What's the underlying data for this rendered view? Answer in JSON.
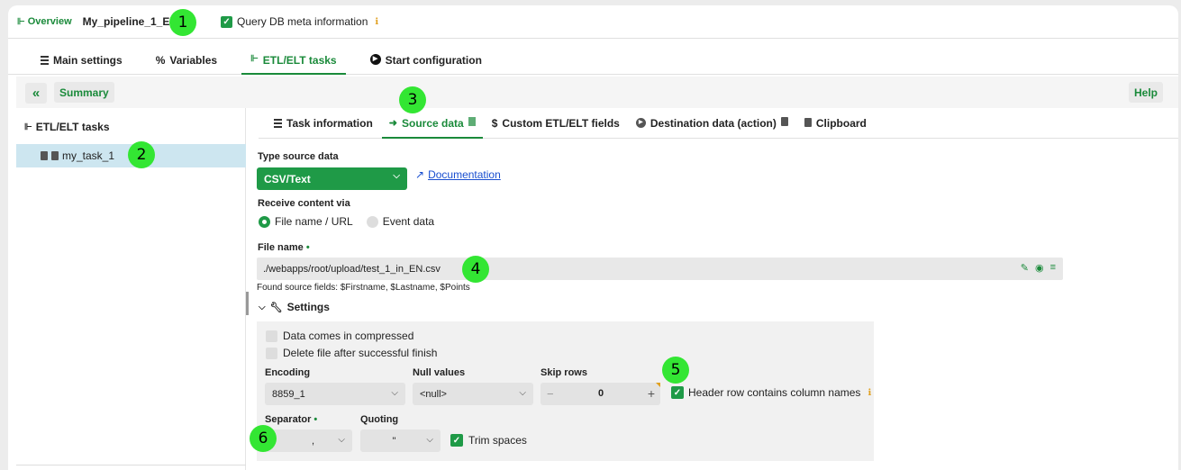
{
  "topbar": {
    "overview_label": "Overview",
    "pipeline_name": "My_pipeline_1_EN",
    "query_db_label": "Query DB meta information",
    "query_db_checked": true
  },
  "main_tabs": [
    {
      "label": "Main settings",
      "icon": "list-icon",
      "active": false
    },
    {
      "label": "Variables",
      "icon": "percent-icon",
      "active": false
    },
    {
      "label": "ETL/ELT tasks",
      "icon": "tree-icon",
      "active": true
    },
    {
      "label": "Start configuration",
      "icon": "play-icon",
      "active": false
    }
  ],
  "toolbar": {
    "collapse_label": "«",
    "summary_label": "Summary",
    "help_label": "Help"
  },
  "left_panel": {
    "title": "ETL/ELT tasks",
    "tasks": [
      {
        "label": "my_task_1",
        "selected": true
      }
    ]
  },
  "task_tabs": [
    {
      "label": "Task information",
      "icon": "list-icon",
      "active": false
    },
    {
      "label": "Source data",
      "icon": "arrow-right-icon",
      "active": true
    },
    {
      "label": "Custom ETL/ELT fields",
      "icon": "dollar-icon",
      "active": false
    },
    {
      "label": "Destination data (action)",
      "icon": "play-icon",
      "active": false
    },
    {
      "label": "Clipboard",
      "icon": "clipboard-icon",
      "active": false
    }
  ],
  "source": {
    "type_label": "Type source data",
    "type_value": "CSV/Text",
    "documentation_label": "Documentation",
    "receive_label": "Receive content via",
    "receive_options": [
      {
        "label": "File name / URL",
        "selected": true
      },
      {
        "label": "Event data",
        "selected": false
      }
    ],
    "file_name_label": "File name",
    "required_mark": "•",
    "file_name_value": "./webapps/root/upload/test_1_in_EN.csv",
    "found_fields": "Found source fields: $Firstname, $Lastname, $Points"
  },
  "settings": {
    "title": "Settings",
    "compressed_label": "Data comes in compressed",
    "delete_label": "Delete file after successful finish",
    "encoding_label": "Encoding",
    "encoding_value": "8859_1",
    "null_label": "Null values",
    "null_value": "<null>",
    "skip_label": "Skip rows",
    "skip_value": "0",
    "minus": "−",
    "plus": "+",
    "header_label": "Header row contains column names",
    "header_checked": true,
    "separator_label": "Separator",
    "separator_value": ",",
    "quoting_label": "Quoting",
    "quoting_value": "\"",
    "trim_label": "Trim spaces",
    "trim_checked": true
  },
  "markers": [
    "1",
    "2",
    "3",
    "4",
    "5",
    "6"
  ],
  "colors": {
    "accent": "#1f9a47",
    "selected_row": "#cde6f0",
    "marker": "#33e633",
    "info": "#e0a020"
  }
}
